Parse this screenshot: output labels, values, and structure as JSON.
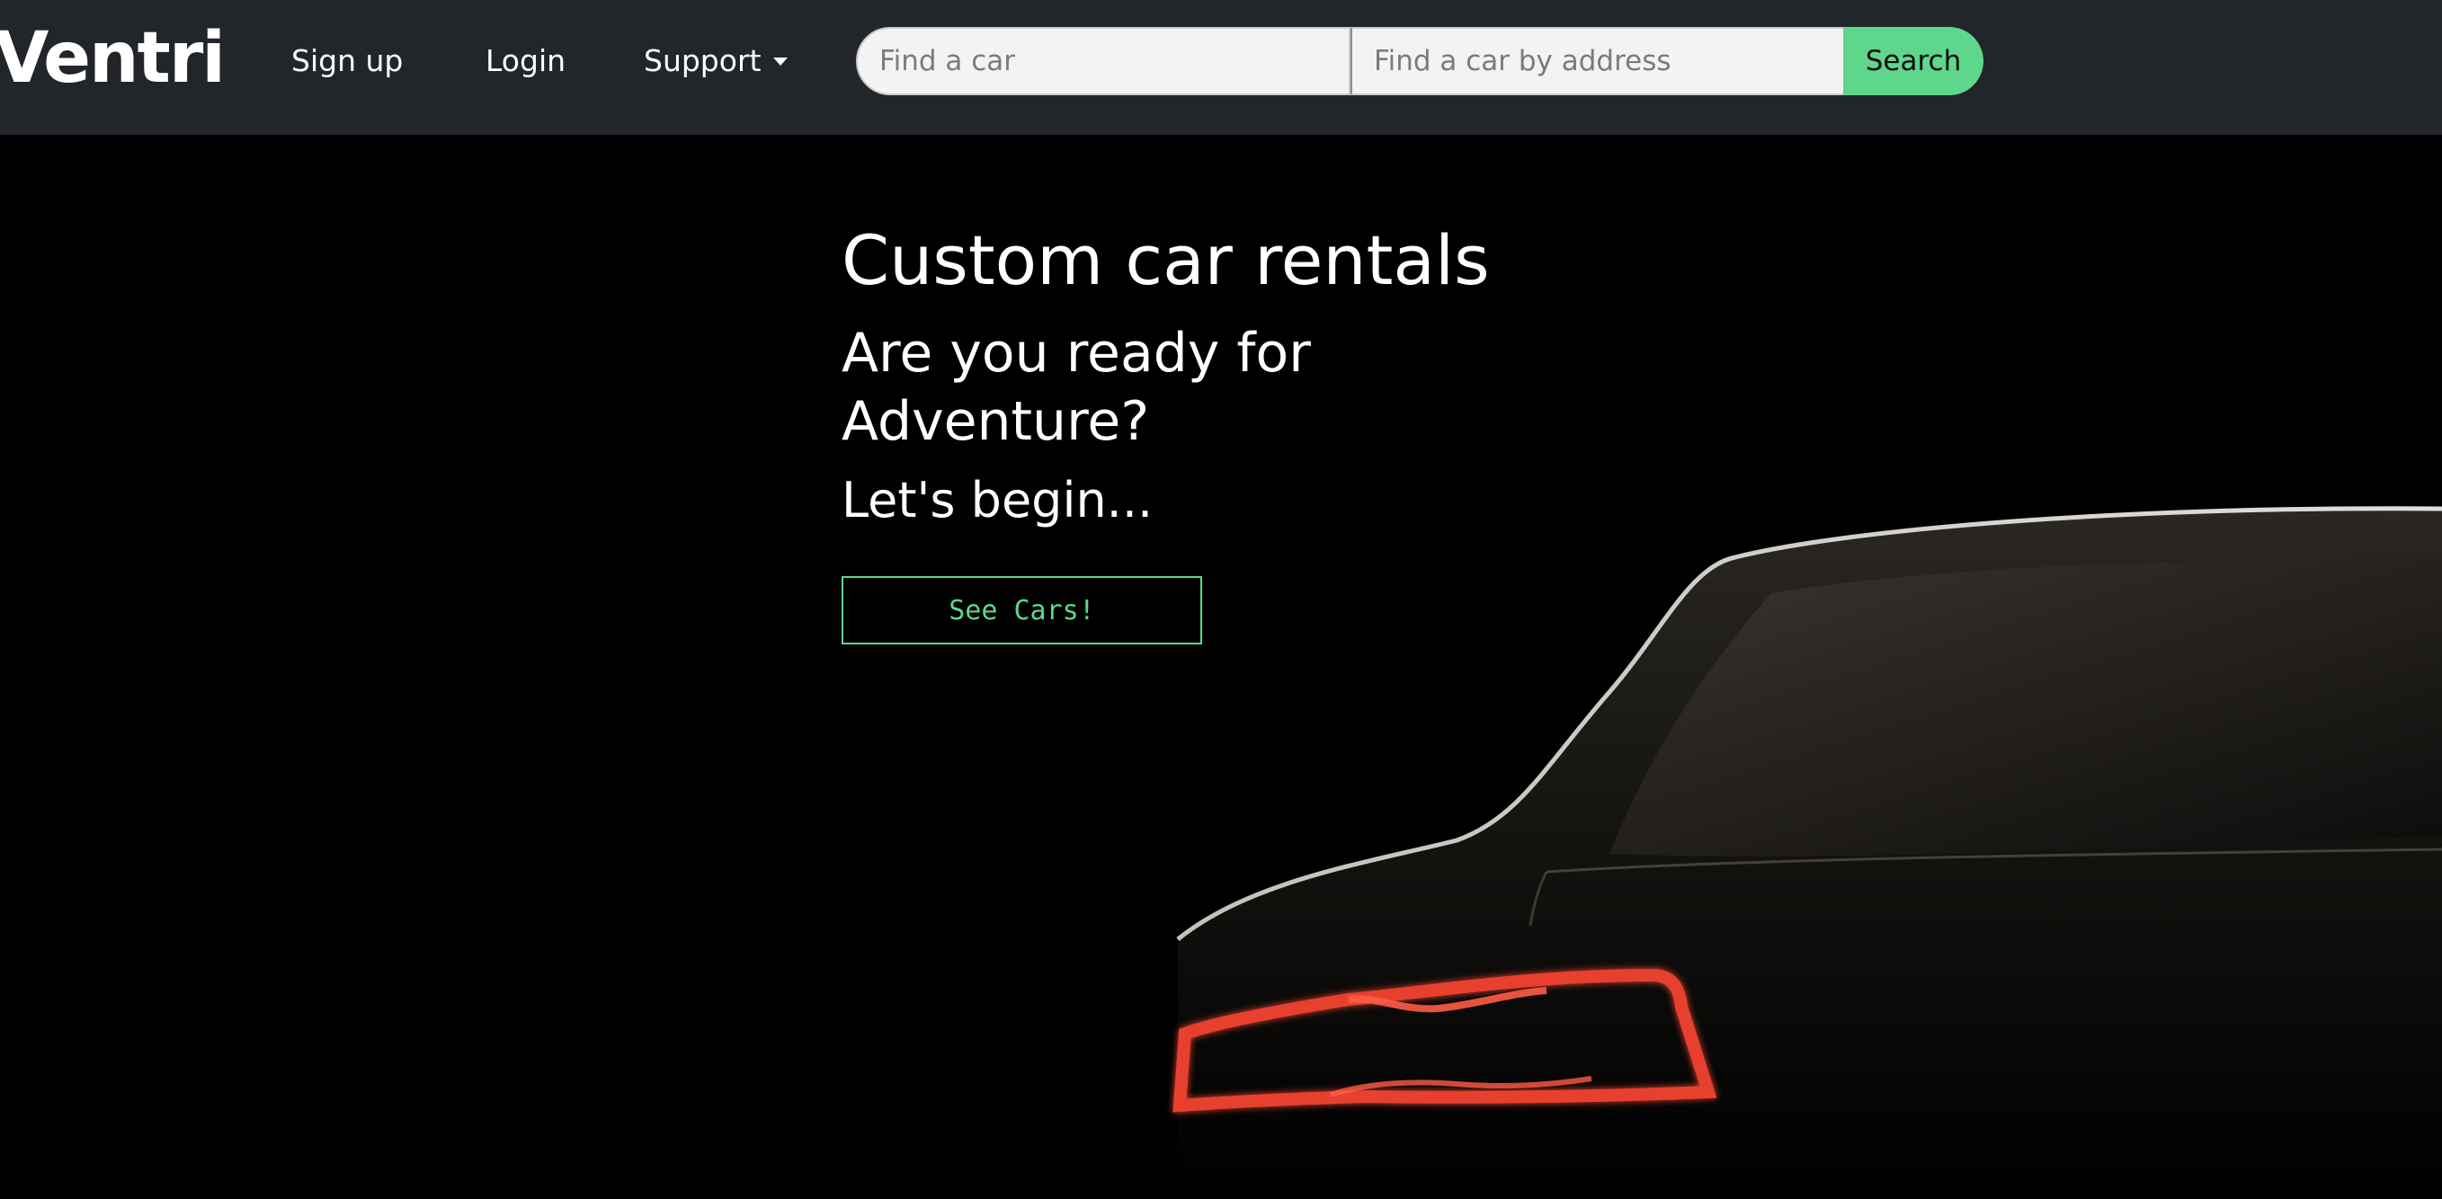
{
  "navbar": {
    "brand": "Ventri",
    "links": [
      {
        "label": "Sign up"
      },
      {
        "label": "Login"
      },
      {
        "label": "Support"
      }
    ],
    "search": {
      "car_placeholder": "Find a car",
      "address_placeholder": "Find a car by address",
      "button_label": "Search"
    }
  },
  "hero": {
    "title": "Custom car rentals",
    "subtitle": "Are you ready for Adventure?",
    "tagline": "Let's begin...",
    "cta_label": "See Cars!"
  },
  "colors": {
    "navbar_bg": "#22262a",
    "accent_green": "#5ed68c",
    "hero_bg": "#000000",
    "taillight_red": "#e8412f"
  },
  "icons": {
    "support_dropdown": "caret-down-icon"
  }
}
